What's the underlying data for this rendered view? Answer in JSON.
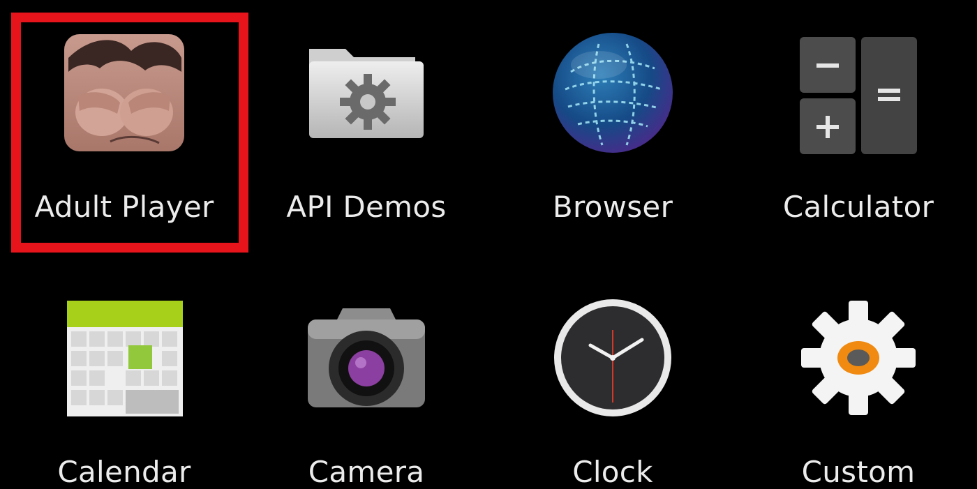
{
  "launcher": {
    "apps": [
      {
        "label": "Adult Player",
        "icon": "adult-player-icon"
      },
      {
        "label": "API Demos",
        "icon": "folder-gear-icon"
      },
      {
        "label": "Browser",
        "icon": "globe-icon"
      },
      {
        "label": "Calculator",
        "icon": "calculator-icon"
      },
      {
        "label": "Calendar",
        "icon": "calendar-icon"
      },
      {
        "label": "Camera",
        "icon": "camera-icon"
      },
      {
        "label": "Clock",
        "icon": "clock-icon"
      },
      {
        "label": "Custom",
        "icon": "gear-icon"
      }
    ],
    "highlight_color": "#e8141c",
    "background": "#000000"
  }
}
